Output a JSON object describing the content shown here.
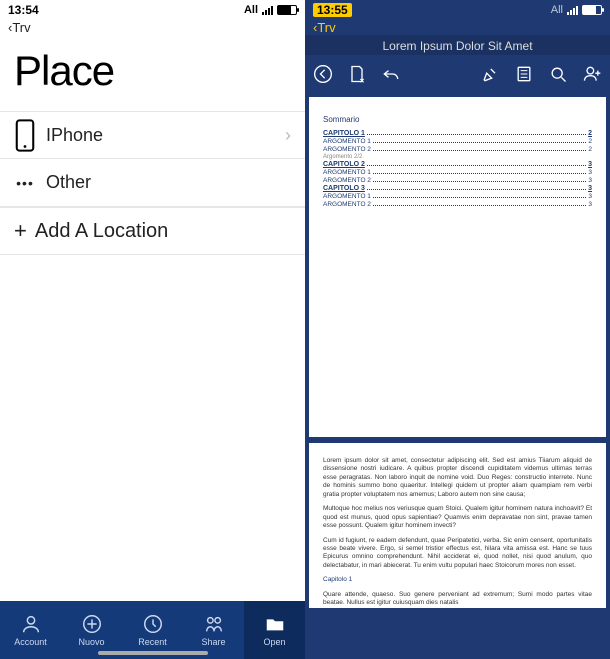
{
  "left": {
    "status": {
      "time": "13:54",
      "net": "All"
    },
    "back": "Trv",
    "title": "Place",
    "rows": [
      {
        "icon": "phone",
        "label": "IPhone"
      },
      {
        "icon": "dots",
        "label": "Other"
      }
    ],
    "add": "Add A Location",
    "tabs": [
      {
        "icon": "account",
        "label": "Account"
      },
      {
        "icon": "new",
        "label": "Nuovo"
      },
      {
        "icon": "recent",
        "label": "Recent"
      },
      {
        "icon": "share",
        "label": "Share"
      },
      {
        "icon": "open",
        "label": "Open"
      }
    ],
    "selected_tab": 4
  },
  "right": {
    "status": {
      "time": "13:55",
      "net": "All"
    },
    "back": "Trv",
    "title": "Lorem Ipsum Dolor Sit Amet",
    "toc_heading": "Sommario",
    "toc": [
      {
        "label": "CAPITOLO 1",
        "page": "2",
        "lvl": "cap"
      },
      {
        "label": "ARGOMENTO 1",
        "page": "2",
        "lvl": "sub"
      },
      {
        "label": "ARGOMENTO 2",
        "page": "2",
        "lvl": "sub"
      },
      {
        "label": "Argomento 2/2",
        "page": "",
        "lvl": "sub2"
      },
      {
        "label": "CAPITOLO 2",
        "page": "3",
        "lvl": "cap"
      },
      {
        "label": "ARGOMENTO 1",
        "page": "3",
        "lvl": "sub"
      },
      {
        "label": "ARGOMENTO 2",
        "page": "3",
        "lvl": "sub"
      },
      {
        "label": "CAPITOLO 3",
        "page": "3",
        "lvl": "cap"
      },
      {
        "label": "ARGOMENTO 1",
        "page": "3",
        "lvl": "sub"
      },
      {
        "label": "ARGOMENTO 2",
        "page": "3",
        "lvl": "sub"
      }
    ],
    "body": {
      "p1": "Lorem ipsum dolor sit amet, consectetur adipiscing elit. Sed est amius Tiiarum aliquid de dissensione nostri iudicare. A quibus propter discendi cupiditatem videmus ultimas terras esse peragratas. Non laboro inquit de nomine void. Duo Reges: constructio interrete. Nunc de hominis summo bono quaeritur. Intellegi quidem ut propter aliam quampiam rem verbi gratia propter voluptatem nos amemus; Laboro autem non sine causa;",
      "p2": "Multoque hoc melius nos veriusque quam Stoici. Qualem igitur hominem natura inchoavit? Et quod est munus, quod opus sapientiae? Quamvis enim depravatae non sint, pravae tamen esse possunt. Qualem igitur hominem invecti?",
      "p3": "Cum id fugiunt, re eadem defendunt, quae Peripatetici, verba. Sic enim censent, oportunitatis esse beate vivere. Ergo, si semel tristior effectus est, hilara vita amissa est. Hanc se tuus Epicurus omnino comprehendunt. Nihil acciderat ei, quod nollet, nisi quod anulum, quo delectabatur, in mari abiecerat. Tu enim vultu populari haec Stoicorum mores non esset.",
      "cap": "Capitolo 1",
      "p4": "Quare attende, quaeso. Suo genere perveniant ad extremum; Sumi modo partes vitae beatae. Nullus est igitur cuiusquam dies natalis"
    }
  }
}
